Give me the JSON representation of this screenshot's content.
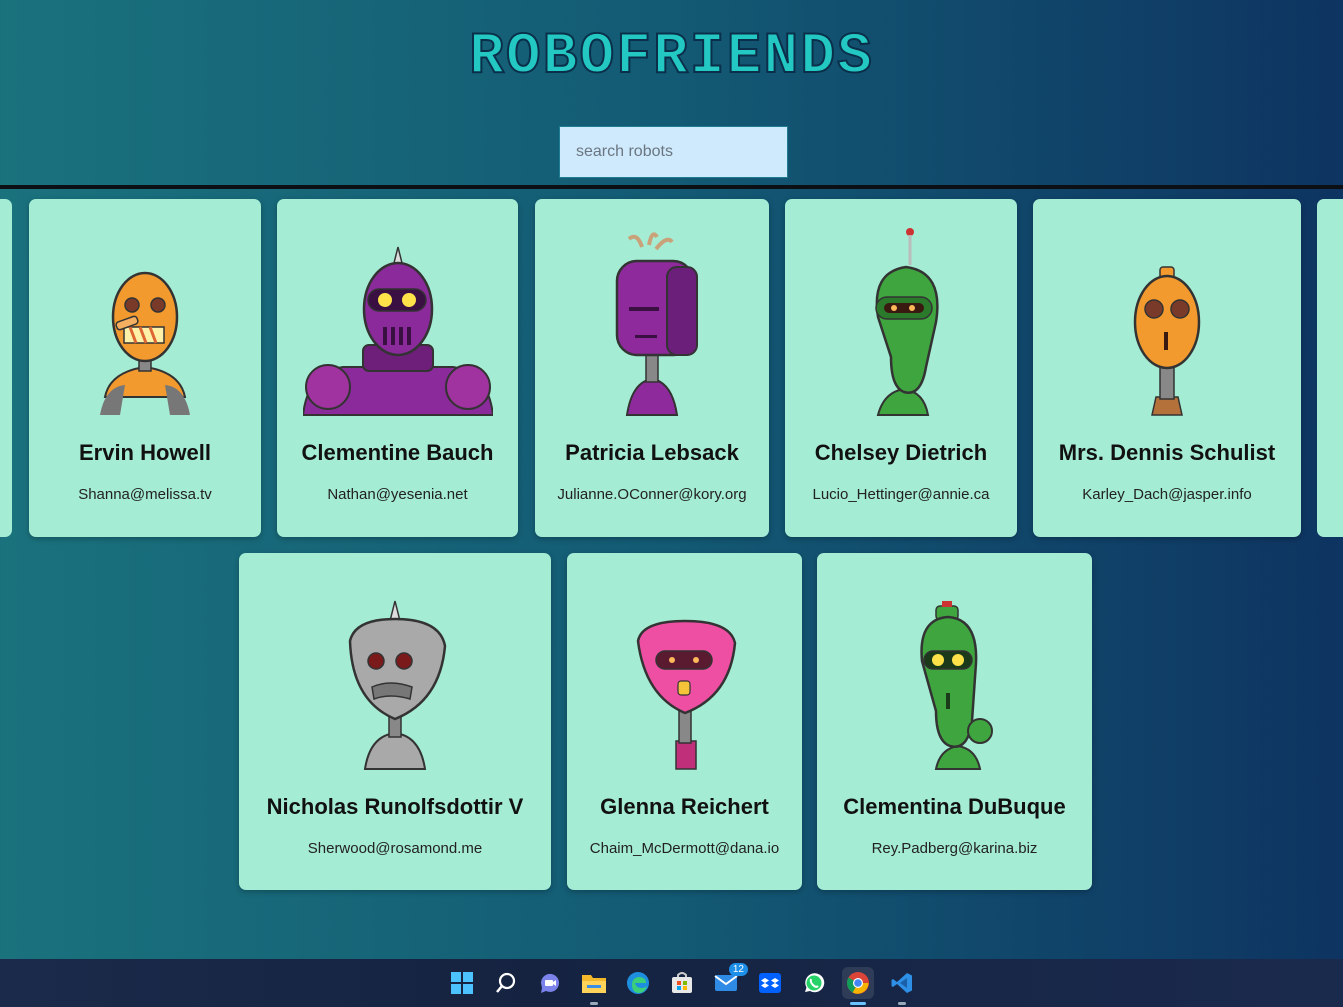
{
  "app": {
    "title": "ROBOFRIENDS",
    "search": {
      "placeholder": "search robots",
      "value": ""
    }
  },
  "robots": [
    {
      "name": "Ervin Howell",
      "email": "Shanna@melissa.tv",
      "color": "#f29a2e"
    },
    {
      "name": "Clementine Bauch",
      "email": "Nathan@yesenia.net",
      "color": "#8b2a9a"
    },
    {
      "name": "Patricia Lebsack",
      "email": "Julianne.OConner@kory.org",
      "color": "#8e2a9c"
    },
    {
      "name": "Chelsey Dietrich",
      "email": "Lucio_Hettinger@annie.ca",
      "color": "#3fa63f"
    },
    {
      "name": "Mrs. Dennis Schulist",
      "email": "Karley_Dach@jasper.info",
      "color": "#f29a2e"
    },
    {
      "name": "Nicholas Runolfsdottir V",
      "email": "Sherwood@rosamond.me",
      "color": "#a9a9a9"
    },
    {
      "name": "Glenna Reichert",
      "email": "Chaim_McDermott@dana.io",
      "color": "#ee4fa3"
    },
    {
      "name": "Clementina DuBuque",
      "email": "Rey.Padberg@karina.biz",
      "color": "#3fa63f"
    }
  ],
  "taskbar": {
    "icons": [
      "windows-start-icon",
      "search-icon",
      "teams-chat-icon",
      "file-explorer-icon",
      "edge-icon",
      "store-icon",
      "mail-icon",
      "dropbox-icon",
      "whatsapp-icon",
      "chrome-icon",
      "vscode-icon"
    ],
    "mail_badge": "12"
  }
}
